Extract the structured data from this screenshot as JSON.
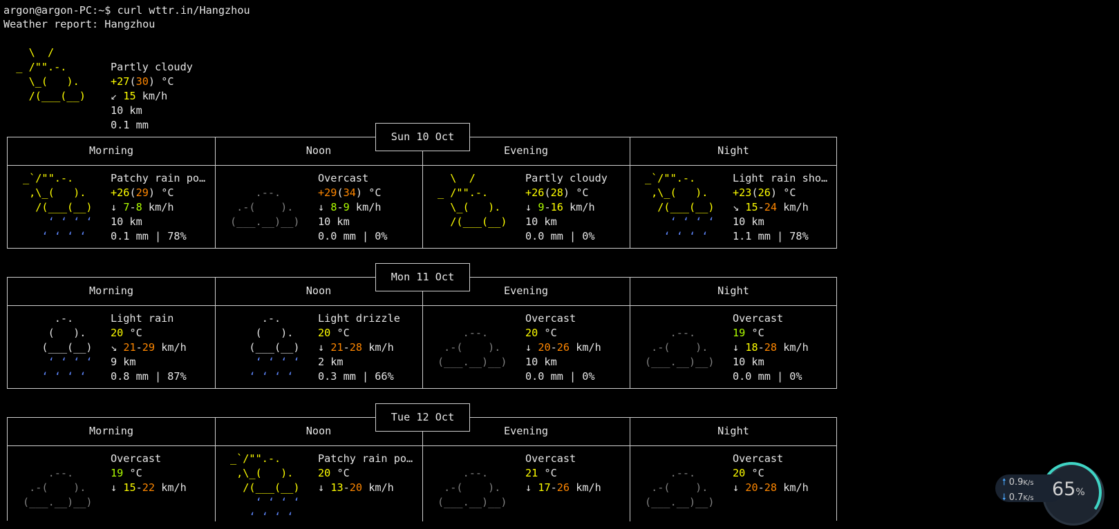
{
  "terminal": {
    "prompt": "argon@argon-PC:~$ curl wttr.in/Hangzhou",
    "report_title": "Weather report: Hangzhou"
  },
  "current": {
    "art": [
      "    \\  /      ",
      "  _ /\"\".-.    ",
      "    \\_(   ).  ",
      "    /(___(__) "
    ],
    "condition": "Partly cloudy",
    "temp": "+27",
    "feels": "30",
    "temp_unit": " °C",
    "wind_arrow": "↙",
    "wind": "15",
    "wind_unit": " km/h",
    "visibility": "10 km",
    "precip": "0.1 mm"
  },
  "periods": [
    "Morning",
    "Noon",
    "Evening",
    "Night"
  ],
  "days": [
    {
      "date": "Sun 10 Oct",
      "cells": [
        {
          "condition": "Patchy rain po…",
          "temp": "+26",
          "feels": "29",
          "wind_arrow": "↓",
          "wind_lo": "7",
          "wind_hi": "8",
          "visibility": "10 km",
          "precip": "0.1 mm | 78%"
        },
        {
          "condition": "Overcast",
          "temp": "+29",
          "feels": "34",
          "wind_arrow": "↓",
          "wind_lo": "8",
          "wind_hi": "9",
          "visibility": "10 km",
          "precip": "0.0 mm | 0%"
        },
        {
          "condition": "Partly cloudy",
          "temp": "+26",
          "feels": "28",
          "wind_arrow": "↓",
          "wind_lo": "9",
          "wind_hi": "16",
          "visibility": "10 km",
          "precip": "0.0 mm | 0%"
        },
        {
          "condition": "Light rain sho…",
          "temp": "+23",
          "feels": "26",
          "wind_arrow": "↘",
          "wind_lo": "15",
          "wind_hi": "24",
          "visibility": "10 km",
          "precip": "1.1 mm | 78%"
        }
      ]
    },
    {
      "date": "Mon 11 Oct",
      "cells": [
        {
          "condition": "Light rain",
          "temp": "20",
          "feels": "",
          "wind_arrow": "↘",
          "wind_lo": "21",
          "wind_hi": "29",
          "visibility": "9 km",
          "precip": "0.8 mm | 87%"
        },
        {
          "condition": "Light drizzle",
          "temp": "20",
          "feels": "",
          "wind_arrow": "↓",
          "wind_lo": "21",
          "wind_hi": "28",
          "visibility": "2 km",
          "precip": "0.3 mm | 66%"
        },
        {
          "condition": "Overcast",
          "temp": "20",
          "feels": "",
          "wind_arrow": "↓",
          "wind_lo": "20",
          "wind_hi": "26",
          "visibility": "10 km",
          "precip": "0.0 mm | 0%"
        },
        {
          "condition": "Overcast",
          "temp": "19",
          "feels": "",
          "wind_arrow": "↓",
          "wind_lo": "18",
          "wind_hi": "28",
          "visibility": "10 km",
          "precip": "0.0 mm | 0%"
        }
      ]
    },
    {
      "date": "Tue 12 Oct",
      "cells": [
        {
          "condition": "Overcast",
          "temp": "19",
          "feels": "",
          "wind_arrow": "↓",
          "wind_lo": "15",
          "wind_hi": "22",
          "visibility": "",
          "precip": ""
        },
        {
          "condition": "Patchy rain po…",
          "temp": "20",
          "feels": "",
          "wind_arrow": "↓",
          "wind_lo": "13",
          "wind_hi": "20",
          "visibility": "",
          "precip": ""
        },
        {
          "condition": "Overcast",
          "temp": "21",
          "feels": "",
          "wind_arrow": "↓",
          "wind_lo": "17",
          "wind_hi": "26",
          "visibility": "",
          "precip": ""
        },
        {
          "condition": "Overcast",
          "temp": "20",
          "feels": "",
          "wind_arrow": "↓",
          "wind_lo": "20",
          "wind_hi": "28",
          "visibility": "",
          "precip": ""
        }
      ]
    }
  ],
  "net_widget": {
    "up": "0.9",
    "up_unit": "K/s",
    "down": "0.7",
    "down_unit": "K/s",
    "cpu": "65",
    "cpu_unit": "%"
  }
}
